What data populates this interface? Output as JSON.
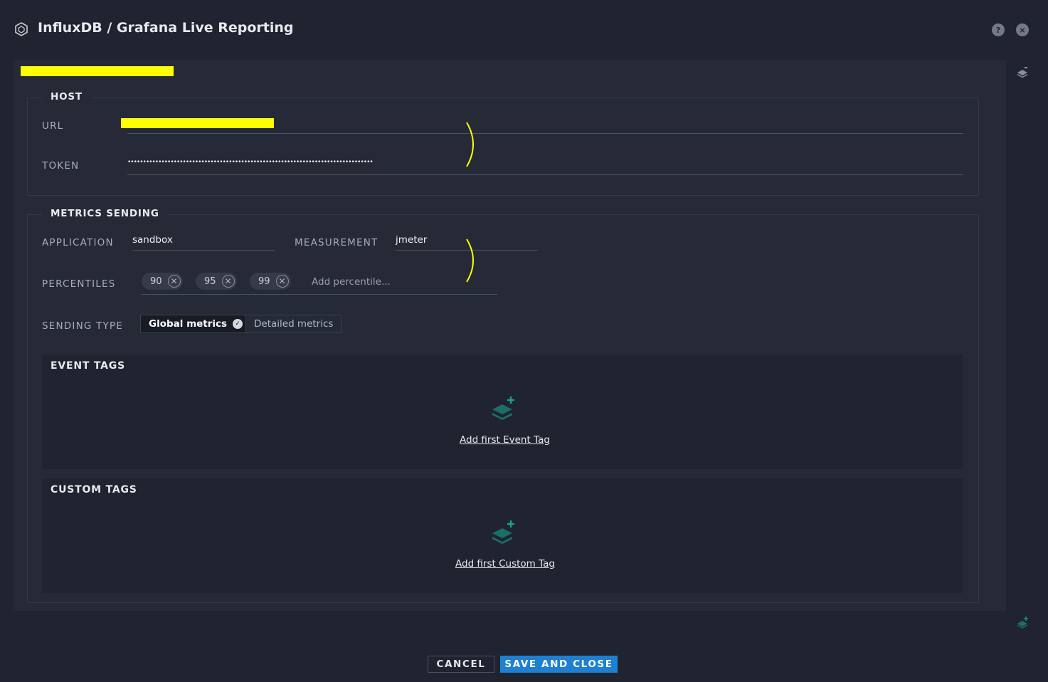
{
  "window": {
    "title": "InfluxDB / Grafana Live Reporting",
    "help_label": "?",
    "close_label": "×"
  },
  "host": {
    "legend": "HOST",
    "url_label": "URL",
    "token_label": "TOKEN",
    "token_value": "••••••••••••••••••••••••••••••••••••••••••••••••••••••••••••••••••••••••••••••••"
  },
  "metrics": {
    "legend": "METRICS SENDING",
    "application_label": "APPLICATION",
    "application_value": "sandbox",
    "measurement_label": "MEASUREMENT",
    "measurement_value": "jmeter",
    "percentiles_label": "PERCENTILES",
    "percentiles": [
      "90",
      "95",
      "99"
    ],
    "percentile_placeholder": "Add percentile...",
    "sending_type_label": "SENDING TYPE",
    "sending_types": [
      "Global metrics",
      "Detailed metrics"
    ],
    "sending_type_selected": "Global metrics"
  },
  "event_tags": {
    "title": "EVENT TAGS",
    "add_link": "Add first Event Tag"
  },
  "custom_tags": {
    "title": "CUSTOM TAGS",
    "add_link": "Add first Custom Tag"
  },
  "footer": {
    "cancel_label": "CANCEL",
    "save_label": "SAVE AND CLOSE"
  },
  "colors": {
    "background": "#1f2430",
    "panel": "#252a36",
    "accent_blue": "#1f7fd0",
    "tag_icon_teal": "#1b8f80",
    "redaction_yellow": "#ffff00"
  },
  "icons": {
    "logo": "hexagon-logo-icon",
    "help": "help-icon",
    "close": "close-icon",
    "layers": "layers-icon",
    "add_tag": "add-layers-icon"
  }
}
